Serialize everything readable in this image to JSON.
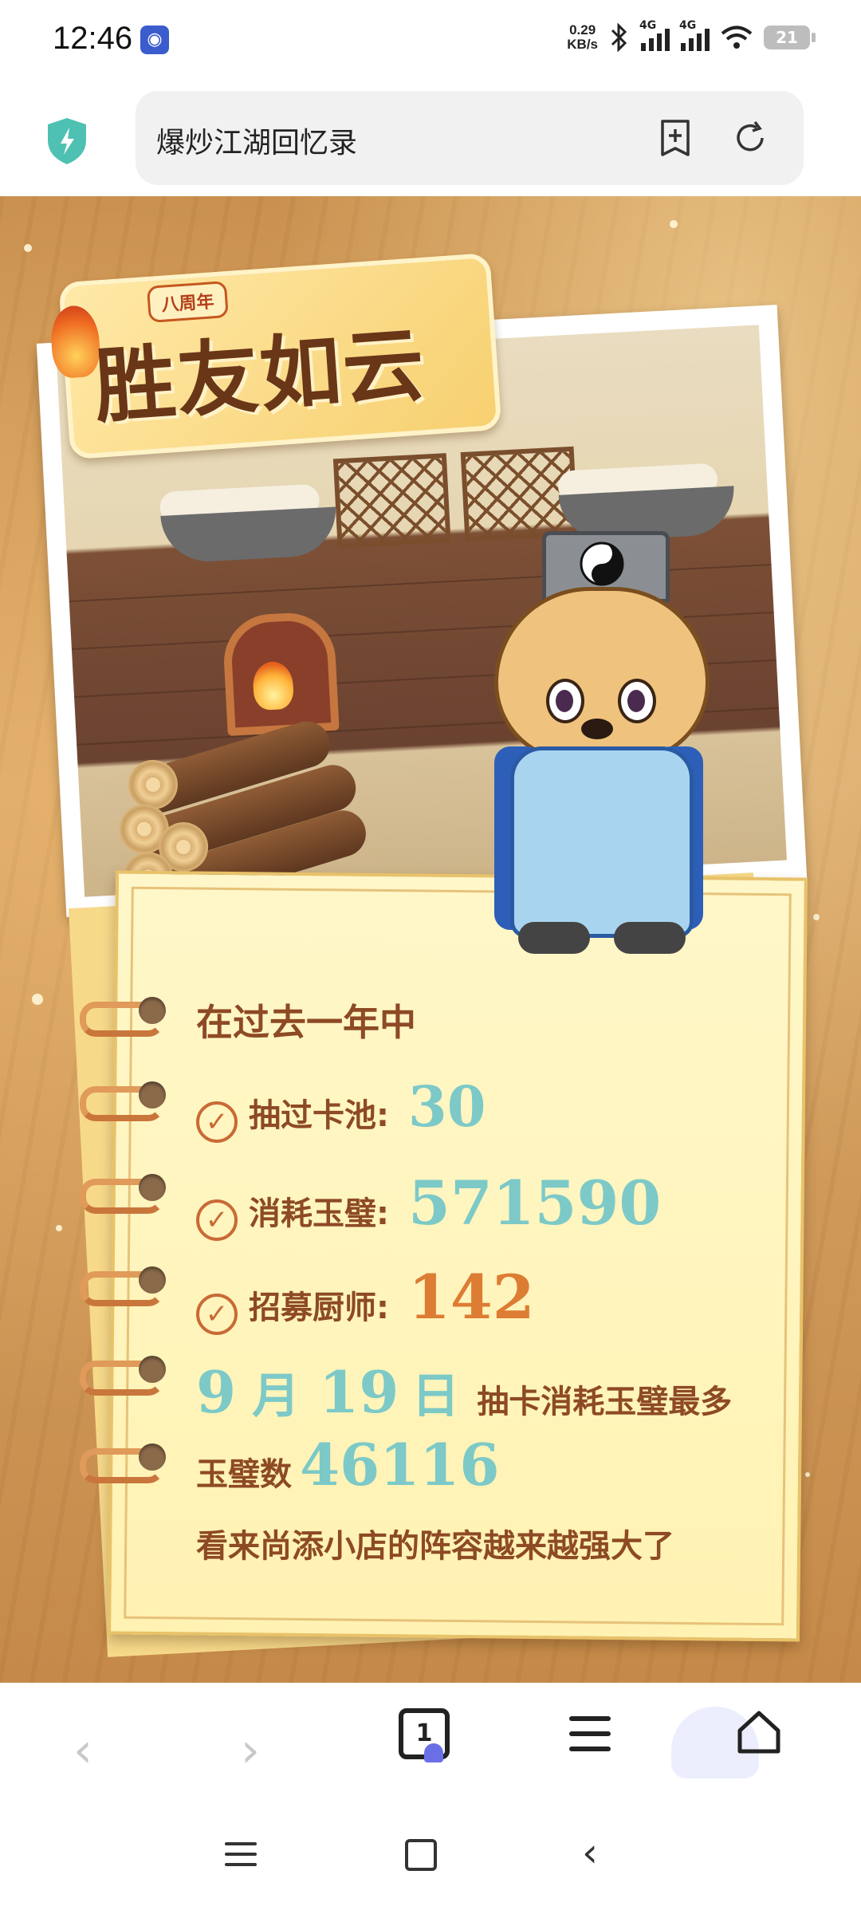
{
  "status": {
    "time": "12:46",
    "net_speed_value": "0.29",
    "net_speed_unit": "KB/s",
    "signal_1_label": "4G",
    "signal_2_label": "4G",
    "battery": "21"
  },
  "browser": {
    "url_text": "爆炒江湖回忆录",
    "tab_count": "1"
  },
  "page": {
    "logo_badge": "八周年",
    "logo_title": "胜友如云",
    "intro": "在过去一年中",
    "stat1_label": "抽过卡池:",
    "stat1_value": "30",
    "stat2_label": "消耗玉璧:",
    "stat2_value": "571590",
    "stat3_label": "招募厨师:",
    "stat3_value": "142",
    "date_month_num": "9",
    "date_month_char": "月",
    "date_day_num": "19",
    "date_day_char": "日",
    "date_suffix": "抽卡消耗玉璧最多",
    "jade_label": "玉璧数",
    "jade_value": "46116",
    "closing": "看来尚添小店的阵容越来越强大了"
  },
  "colors": {
    "teal_number": "#7cc9c8",
    "orange_number": "#dd7c33",
    "text_brown": "#8d4a24"
  }
}
